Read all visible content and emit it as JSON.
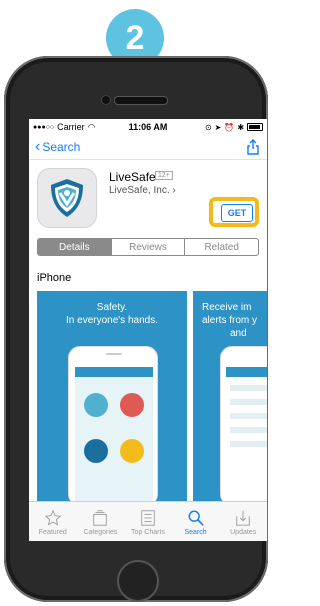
{
  "step_badge": "2",
  "status_bar": {
    "carrier": "Carrier",
    "time": "11:06 AM"
  },
  "navbar": {
    "back_label": "Search"
  },
  "app": {
    "name": "LiveSafe",
    "age_rating": "12+",
    "developer": "LiveSafe, Inc.",
    "get_label": "GET"
  },
  "segments": [
    "Details",
    "Reviews",
    "Related"
  ],
  "section_label": "iPhone",
  "screenshots": {
    "first_caption_line1": "Safety.",
    "first_caption_line2": "In everyone's hands.",
    "second_caption_line1": "Receive im",
    "second_caption_line2": "alerts from y",
    "second_caption_line3": "and"
  },
  "tabbar": {
    "featured": "Featured",
    "categories": "Categories",
    "top_charts": "Top Charts",
    "search": "Search",
    "updates": "Updates"
  },
  "colors": {
    "accent": "#157efb",
    "highlight": "#f2bb1b",
    "badge": "#5ec3e0",
    "screenshot_bg": "#2d93c7"
  }
}
